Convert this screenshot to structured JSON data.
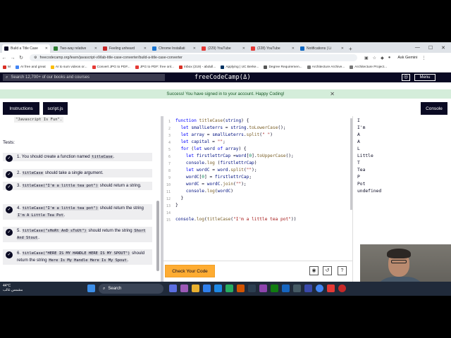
{
  "browser": {
    "tabs": [
      {
        "label": "Build a Title Case",
        "active": true,
        "color": "#0a0a23"
      },
      {
        "label": "Two-way relative",
        "active": false,
        "color": "#2e7d32"
      },
      {
        "label": "Feeling unheard",
        "active": false,
        "color": "#c62828"
      },
      {
        "label": "Chrome Installati",
        "active": false,
        "color": "#1976d2"
      },
      {
        "label": "(229) YouTube",
        "active": false,
        "color": "#e53935"
      },
      {
        "label": "(228) YouTube",
        "active": false,
        "color": "#e53935"
      },
      {
        "label": "Notifications | Li",
        "active": false,
        "color": "#0a66c2"
      }
    ],
    "new_tab": "+",
    "url": "freecodecamp.org/learn/javascript-v9/lab-title-case-converter/build-a-title-case-converter",
    "ask_gemini": "Ask Gemini",
    "bookmarks": [
      {
        "label": "M",
        "color": "#d93025"
      },
      {
        "label": "AI free and great",
        "color": "#4285f4"
      },
      {
        "label": "AI to sum videos or...",
        "color": "#fbbc04"
      },
      {
        "label": "Convert JPG to PDF...",
        "color": "#e53935"
      },
      {
        "label": "JPG to PDF: free onl...",
        "color": "#e53935"
      },
      {
        "label": "Inbox (219) - abdull...",
        "color": "#d93025"
      },
      {
        "label": "Applying | UC Berke...",
        "color": "#003262"
      },
      {
        "label": "Degree Requiremen...",
        "color": "#555555"
      },
      {
        "label": "Architecture Archive...",
        "color": "#777777"
      },
      {
        "label": "Architecture Project...",
        "color": "#777777"
      }
    ]
  },
  "fcc_nav": {
    "search_placeholder": "Search 12,700+ of our books and courses",
    "logo": "freeCodeCamp(Δ)",
    "menu_label": "Menu"
  },
  "success_message": "Success! You have signed in to your account. Happy Coding!",
  "toolbar": {
    "instructions_label": "Instructions",
    "script_label": "script.js",
    "console_label": "Console"
  },
  "left_pane": {
    "quote_text": "\"Javascript Is Fun\".",
    "tests_heading": "Tests:",
    "tests": [
      {
        "num": "1.",
        "parts": [
          [
            "t",
            "You should create a function named "
          ],
          [
            "c",
            "titleCase"
          ],
          [
            "t",
            "."
          ]
        ]
      },
      {
        "num": "2.",
        "parts": [
          [
            "c",
            "titleCase"
          ],
          [
            "t",
            " should take a single argument."
          ]
        ]
      },
      {
        "num": "3.",
        "parts": [
          [
            "c",
            "titleCase(\"I'm a little tea pot\")"
          ],
          [
            "t",
            " should return a string."
          ]
        ]
      },
      {
        "num": "4.",
        "parts": [
          [
            "c",
            "titleCase(\"I'm a little tea pot\")"
          ],
          [
            "t",
            " should return the string "
          ],
          [
            "c",
            "I'm A Little Tea Pot"
          ],
          [
            "t",
            "."
          ]
        ]
      },
      {
        "num": "5.",
        "parts": [
          [
            "c",
            "titleCase(\"sHoRt AnD sToUt\")"
          ],
          [
            "t",
            " should return the string "
          ],
          [
            "c",
            "Short And Stout"
          ],
          [
            "t",
            "."
          ]
        ]
      },
      {
        "num": "6.",
        "parts": [
          [
            "c",
            "titleCase(\"HERE IS MY HANDLE HERE IS MY SPOUT\")"
          ],
          [
            "t",
            " should return the string "
          ],
          [
            "c",
            "Here Is My Handle Here Is My Spout"
          ],
          [
            "t",
            "."
          ]
        ]
      }
    ]
  },
  "editor": {
    "line_numbers": [
      "1",
      "2",
      "3",
      "4",
      "5",
      "6",
      "7",
      "8",
      "9",
      "10",
      "11",
      "12",
      "13",
      "14",
      "15"
    ],
    "check_button_label": "Check Your Code"
  },
  "console_output": [
    "I",
    "I'm",
    "A",
    "A",
    "L",
    "Little",
    "T",
    "Tea",
    "P",
    "Pot",
    "undefined"
  ],
  "taskbar": {
    "weather_temp": "44°C",
    "weather_text": "مشمس غالب",
    "search_label": "Search"
  }
}
